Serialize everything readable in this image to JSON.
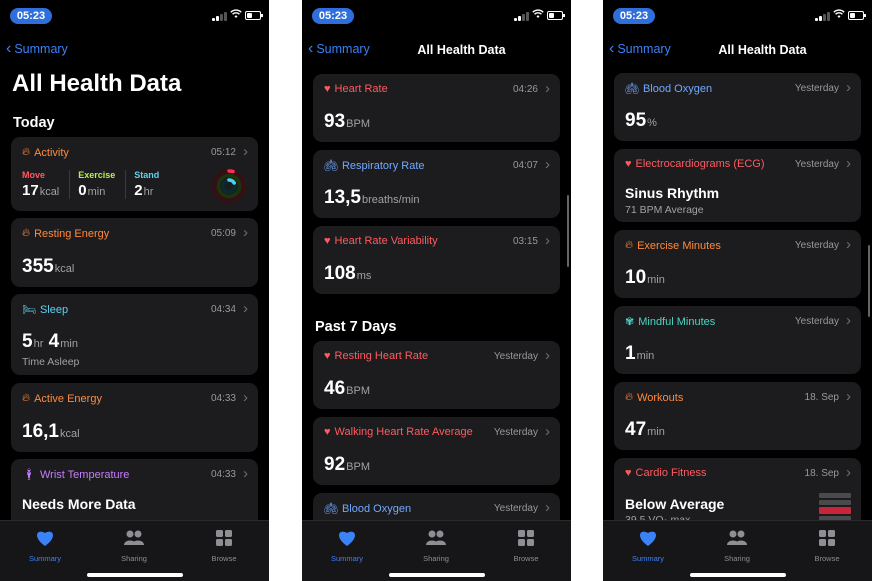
{
  "status": {
    "time": "05:23"
  },
  "phones": [
    {
      "back_label": "Summary",
      "nav_title": "",
      "big_title": "All Health Data",
      "section": "Today",
      "activity": {
        "title": "Activity",
        "time": "05:12",
        "move_label": "Move",
        "move_value": "17",
        "move_unit": "kcal",
        "exercise_label": "Exercise",
        "exercise_value": "0",
        "exercise_unit": "min",
        "stand_label": "Stand",
        "stand_value": "2",
        "stand_unit": "hr"
      },
      "resting_energy": {
        "title": "Resting Energy",
        "time": "05:09",
        "value": "355",
        "unit": "kcal"
      },
      "sleep": {
        "title": "Sleep",
        "time": "04:34",
        "hours": "5",
        "hours_unit": "hr",
        "mins": "4",
        "mins_unit": "min",
        "sub": "Time Asleep"
      },
      "active_energy": {
        "title": "Active Energy",
        "time": "04:33",
        "value": "16,1",
        "unit": "kcal"
      },
      "wrist_temp": {
        "title": "Wrist Temperature",
        "time": "04:33",
        "value": "Needs More Data"
      }
    },
    {
      "back_label": "Summary",
      "nav_title": "All Health Data",
      "heart_rate": {
        "title": "Heart Rate",
        "time": "04:26",
        "value": "93",
        "unit": "BPM"
      },
      "respiratory": {
        "title": "Respiratory Rate",
        "time": "04:07",
        "value": "13,5",
        "unit": "breaths/min"
      },
      "hrv": {
        "title": "Heart Rate Variability",
        "time": "03:15",
        "value": "108",
        "unit": "ms"
      },
      "section": "Past 7 Days",
      "resting_hr": {
        "title": "Resting Heart Rate",
        "time": "Yesterday",
        "value": "46",
        "unit": "BPM"
      },
      "walking_hr": {
        "title": "Walking Heart Rate Average",
        "time": "Yesterday",
        "value": "92",
        "unit": "BPM"
      },
      "blood_oxygen": {
        "title": "Blood Oxygen",
        "time": "Yesterday"
      }
    },
    {
      "back_label": "Summary",
      "nav_title": "All Health Data",
      "blood_oxygen": {
        "title": "Blood Oxygen",
        "time": "Yesterday",
        "value": "95",
        "unit": "%"
      },
      "ecg": {
        "title": "Electrocardiograms (ECG)",
        "time": "Yesterday",
        "value": "Sinus Rhythm",
        "sub": "71 BPM Average"
      },
      "exercise": {
        "title": "Exercise Minutes",
        "time": "Yesterday",
        "value": "10",
        "unit": "min"
      },
      "mindful": {
        "title": "Mindful Minutes",
        "time": "Yesterday",
        "value": "1",
        "unit": "min"
      },
      "workouts": {
        "title": "Workouts",
        "time": "18. Sep",
        "value": "47",
        "unit": "min"
      },
      "cardio": {
        "title": "Cardio Fitness",
        "time": "18. Sep",
        "value": "Below Average",
        "sub": "39,5 VO₂ max"
      }
    }
  ],
  "tabs": [
    {
      "label": "Summary",
      "icon": "heart-icon"
    },
    {
      "label": "Sharing",
      "icon": "people-icon"
    },
    {
      "label": "Browse",
      "icon": "grid-icon"
    }
  ],
  "colors": {
    "accent": "#3b82f6",
    "card": "#1c1c1e",
    "heart": "#ff5a5f",
    "energy": "#ff8a3d"
  }
}
